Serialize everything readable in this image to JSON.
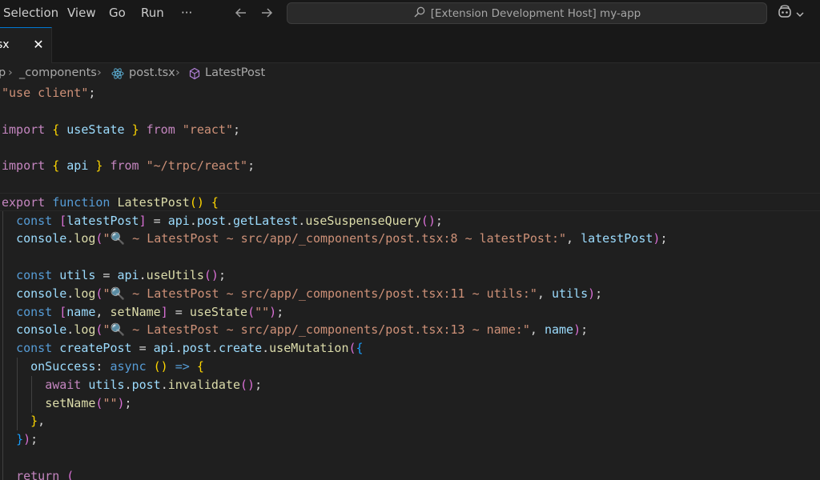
{
  "menu": {
    "items": [
      "Selection",
      "View",
      "Go",
      "Run",
      "···"
    ]
  },
  "search": {
    "text": "[Extension Development Host] my-app"
  },
  "tab": {
    "label": "sx",
    "close": "✕"
  },
  "breadcrumb": {
    "items": [
      "p",
      "_components",
      "post.tsx",
      "LatestPost"
    ]
  },
  "icons": {
    "back": "arrow-left-icon",
    "forward": "arrow-right-icon",
    "search": "search-icon",
    "copilot": "copilot-icon",
    "react": "react-icon",
    "symbol": "method-symbol-icon"
  },
  "colors": {
    "accent": "#0078d4",
    "keyword": "#569cd6",
    "control": "#c586c0",
    "function": "#dcdcaa",
    "string": "#ce9178",
    "variable": "#9cdcfe"
  },
  "code": {
    "lines": [
      [
        [
          "str",
          "\"use client\""
        ],
        [
          "pl",
          ";"
        ]
      ],
      [],
      [
        [
          "kwc",
          "import"
        ],
        [
          "pl",
          " "
        ],
        [
          "br1",
          "{"
        ],
        [
          "pl",
          " "
        ],
        [
          "var",
          "useState"
        ],
        [
          "pl",
          " "
        ],
        [
          "br1",
          "}"
        ],
        [
          "pl",
          " "
        ],
        [
          "kwc",
          "from"
        ],
        [
          "pl",
          " "
        ],
        [
          "str",
          "\"react\""
        ],
        [
          "pl",
          ";"
        ]
      ],
      [],
      [
        [
          "kwc",
          "import"
        ],
        [
          "pl",
          " "
        ],
        [
          "br1",
          "{"
        ],
        [
          "pl",
          " "
        ],
        [
          "var",
          "api"
        ],
        [
          "pl",
          " "
        ],
        [
          "br1",
          "}"
        ],
        [
          "pl",
          " "
        ],
        [
          "kwc",
          "from"
        ],
        [
          "pl",
          " "
        ],
        [
          "str",
          "\"~/trpc/react\""
        ],
        [
          "pl",
          ";"
        ]
      ],
      [],
      [
        [
          "kwc",
          "export"
        ],
        [
          "pl",
          " "
        ],
        [
          "kw",
          "function"
        ],
        [
          "pl",
          " "
        ],
        [
          "fn",
          "LatestPost"
        ],
        [
          "br1",
          "()"
        ],
        [
          "pl",
          " "
        ],
        [
          "br1",
          "{"
        ]
      ],
      [
        [
          "pl",
          "  "
        ],
        [
          "kw",
          "const"
        ],
        [
          "pl",
          " "
        ],
        [
          "br2",
          "["
        ],
        [
          "var",
          "latestPost"
        ],
        [
          "br2",
          "]"
        ],
        [
          "pl",
          " = "
        ],
        [
          "var",
          "api"
        ],
        [
          "pl",
          "."
        ],
        [
          "var",
          "post"
        ],
        [
          "pl",
          "."
        ],
        [
          "var",
          "getLatest"
        ],
        [
          "pl",
          "."
        ],
        [
          "fn",
          "useSuspenseQuery"
        ],
        [
          "br2",
          "()"
        ],
        [
          "pl",
          ";"
        ]
      ],
      [
        [
          "pl",
          "  "
        ],
        [
          "var",
          "console"
        ],
        [
          "pl",
          "."
        ],
        [
          "fn",
          "log"
        ],
        [
          "br2",
          "("
        ],
        [
          "str",
          "\"🔍 ~ LatestPost ~ src/app/_components/post.tsx:8 ~ latestPost:\""
        ],
        [
          "pl",
          ", "
        ],
        [
          "var",
          "latestPost"
        ],
        [
          "br2",
          ")"
        ],
        [
          "pl",
          ";"
        ]
      ],
      [],
      [
        [
          "pl",
          "  "
        ],
        [
          "kw",
          "const"
        ],
        [
          "pl",
          " "
        ],
        [
          "var",
          "utils"
        ],
        [
          "pl",
          " = "
        ],
        [
          "var",
          "api"
        ],
        [
          "pl",
          "."
        ],
        [
          "fn",
          "useUtils"
        ],
        [
          "br2",
          "()"
        ],
        [
          "pl",
          ";"
        ]
      ],
      [
        [
          "pl",
          "  "
        ],
        [
          "var",
          "console"
        ],
        [
          "pl",
          "."
        ],
        [
          "fn",
          "log"
        ],
        [
          "br2",
          "("
        ],
        [
          "str",
          "\"🔍 ~ LatestPost ~ src/app/_components/post.tsx:11 ~ utils:\""
        ],
        [
          "pl",
          ", "
        ],
        [
          "var",
          "utils"
        ],
        [
          "br2",
          ")"
        ],
        [
          "pl",
          ";"
        ]
      ],
      [
        [
          "pl",
          "  "
        ],
        [
          "kw",
          "const"
        ],
        [
          "pl",
          " "
        ],
        [
          "br2",
          "["
        ],
        [
          "var",
          "name"
        ],
        [
          "pl",
          ", "
        ],
        [
          "fn",
          "setName"
        ],
        [
          "br2",
          "]"
        ],
        [
          "pl",
          " = "
        ],
        [
          "fn",
          "useState"
        ],
        [
          "br2",
          "("
        ],
        [
          "str",
          "\"\""
        ],
        [
          "br2",
          ")"
        ],
        [
          "pl",
          ";"
        ]
      ],
      [
        [
          "pl",
          "  "
        ],
        [
          "var",
          "console"
        ],
        [
          "pl",
          "."
        ],
        [
          "fn",
          "log"
        ],
        [
          "br2",
          "("
        ],
        [
          "str",
          "\"🔍 ~ LatestPost ~ src/app/_components/post.tsx:13 ~ name:\""
        ],
        [
          "pl",
          ", "
        ],
        [
          "var",
          "name"
        ],
        [
          "br2",
          ")"
        ],
        [
          "pl",
          ";"
        ]
      ],
      [
        [
          "pl",
          "  "
        ],
        [
          "kw",
          "const"
        ],
        [
          "pl",
          " "
        ],
        [
          "var",
          "createPost"
        ],
        [
          "pl",
          " = "
        ],
        [
          "var",
          "api"
        ],
        [
          "pl",
          "."
        ],
        [
          "var",
          "post"
        ],
        [
          "pl",
          "."
        ],
        [
          "var",
          "create"
        ],
        [
          "pl",
          "."
        ],
        [
          "fn",
          "useMutation"
        ],
        [
          "br2",
          "("
        ],
        [
          "br3",
          "{"
        ]
      ],
      [
        [
          "pl",
          "    "
        ],
        [
          "prop",
          "onSuccess"
        ],
        [
          "pl",
          ": "
        ],
        [
          "kw",
          "async"
        ],
        [
          "pl",
          " "
        ],
        [
          "br1",
          "()"
        ],
        [
          "pl",
          " "
        ],
        [
          "kw",
          "=>"
        ],
        [
          "pl",
          " "
        ],
        [
          "br1",
          "{"
        ]
      ],
      [
        [
          "pl",
          "      "
        ],
        [
          "kwc",
          "await"
        ],
        [
          "pl",
          " "
        ],
        [
          "var",
          "utils"
        ],
        [
          "pl",
          "."
        ],
        [
          "var",
          "post"
        ],
        [
          "pl",
          "."
        ],
        [
          "fn",
          "invalidate"
        ],
        [
          "br2",
          "()"
        ],
        [
          "pl",
          ";"
        ]
      ],
      [
        [
          "pl",
          "      "
        ],
        [
          "fn",
          "setName"
        ],
        [
          "br2",
          "("
        ],
        [
          "str",
          "\"\""
        ],
        [
          "br2",
          ")"
        ],
        [
          "pl",
          ";"
        ]
      ],
      [
        [
          "pl",
          "    "
        ],
        [
          "br1",
          "}"
        ],
        [
          "pl",
          ","
        ]
      ],
      [
        [
          "pl",
          "  "
        ],
        [
          "br3",
          "}"
        ],
        [
          "br2",
          ")"
        ],
        [
          "pl",
          ";"
        ]
      ],
      [],
      [
        [
          "pl",
          "  "
        ],
        [
          "kwc",
          "return"
        ],
        [
          "pl",
          " "
        ],
        [
          "br2",
          "("
        ]
      ]
    ]
  }
}
